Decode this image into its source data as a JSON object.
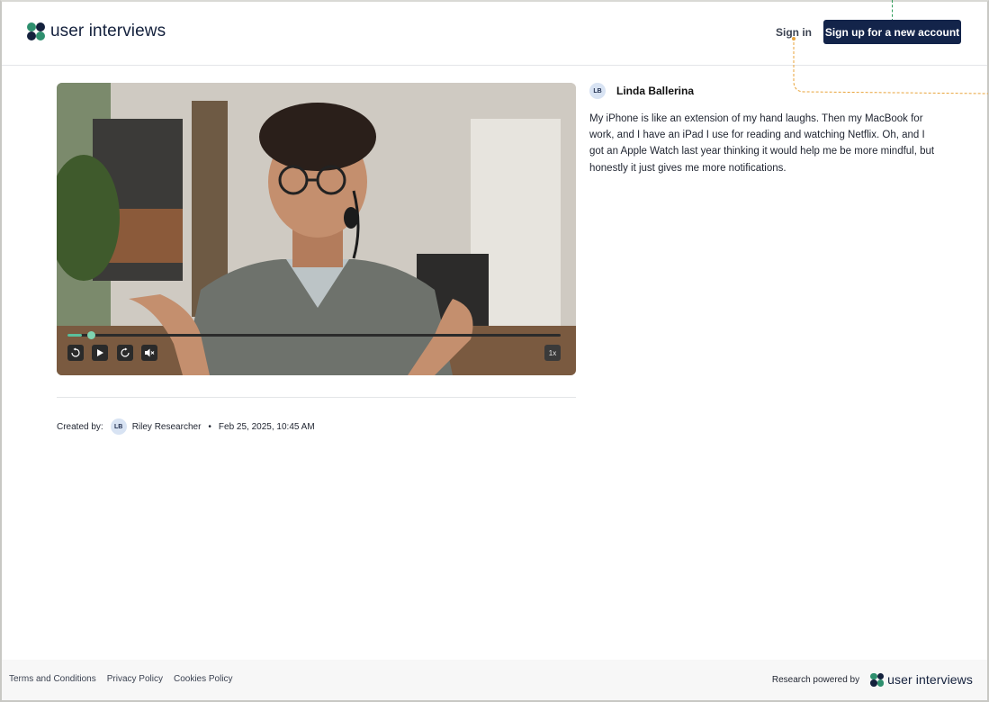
{
  "header": {
    "brand": "user interviews",
    "sign_in": "Sign in",
    "signup": "Sign up for a new account"
  },
  "video": {
    "progress": 0.03,
    "controls": {
      "rewind_icon": "rewind-10-icon",
      "play_icon": "play-icon",
      "forward_icon": "forward-10-icon",
      "mute_icon": "mute-icon",
      "speed": "1x"
    }
  },
  "meta": {
    "created_by_label": "Created by:",
    "creator_initials": "LB",
    "creator_name": "Riley Researcher",
    "bullet": "•",
    "timestamp": "Feb 25, 2025, 10:45 AM"
  },
  "transcript": {
    "speaker_initials": "LB",
    "speaker_name": "Linda Ballerina",
    "text": "My iPhone is like an extension of my hand laughs. Then my MacBook for work, and I have an iPad I use for reading and watching Netflix. Oh, and I got an Apple Watch last year thinking it would help me be more mindful, but honestly it just gives me more notifications."
  },
  "footer": {
    "links": [
      "Terms and Conditions",
      "Privacy Policy",
      "Cookies Policy"
    ],
    "powered_by": "Research powered by",
    "brand": "user interviews"
  },
  "colors": {
    "primary": "#13244a",
    "accent": "#5bbf9c",
    "logo_dark": "#14213d",
    "logo_green": "#2e8f6e"
  }
}
